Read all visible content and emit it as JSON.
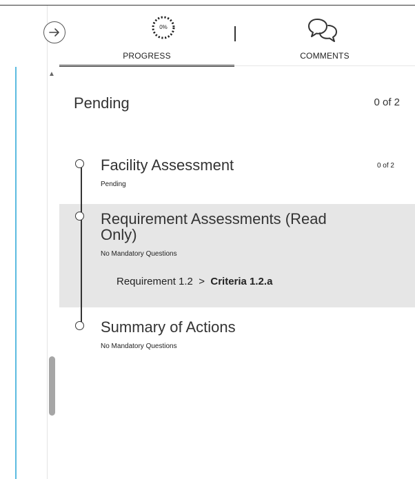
{
  "tabs": {
    "progress": {
      "label": "PROGRESS",
      "percent_label": "0%",
      "percent": 0
    },
    "comments": {
      "label": "COMMENTS"
    }
  },
  "section": {
    "title": "Pending",
    "count": "0 of 2"
  },
  "items": [
    {
      "title": "Facility Assessment",
      "subtitle": "Pending",
      "count": "0 of 2"
    },
    {
      "title_line1": "Requirement Assessments (Read",
      "title_line2": "Only)",
      "subtitle": "No Mandatory Questions",
      "breadcrumb": {
        "parent": "Requirement 1.2",
        "separator": ">",
        "current": "Criteria 1.2.a"
      }
    },
    {
      "title": "Summary of Actions",
      "subtitle": "No Mandatory Questions"
    }
  ],
  "colors": {
    "accent_line": "#5bbbe0",
    "highlight": "#e6e6e6",
    "scroll_thumb": "#a6a6a6"
  },
  "icons": {
    "nav_toggle": "arrow-right-circle-icon",
    "progress": "progress-ring-icon",
    "comments": "speech-bubbles-icon",
    "scroll_up": "triangle-up-icon"
  }
}
